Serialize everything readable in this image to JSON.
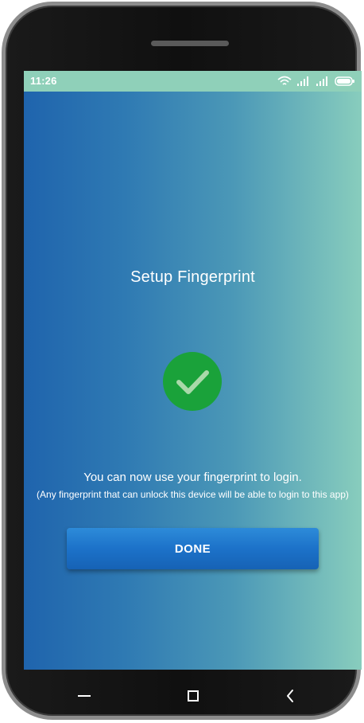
{
  "status_bar": {
    "time": "11:26",
    "icons": [
      "wifi-icon",
      "signal-icon",
      "signal-icon",
      "battery-icon"
    ]
  },
  "screen": {
    "title": "Setup Fingerprint",
    "success_icon": "check-circle-icon",
    "message": "You can now use your fingerprint to login.",
    "note": "(Any fingerprint that can unlock this device will be able to login to this app)",
    "done_label": "DONE"
  },
  "navigation": {
    "buttons": [
      "menu-icon",
      "home-icon",
      "back-icon"
    ]
  },
  "colors": {
    "status_bar": "#8fd0b9",
    "gradient_left": "#1f64ad",
    "gradient_right": "#88cdbd",
    "success_green": "#1aa23a",
    "button_blue": "#1c72c9"
  }
}
